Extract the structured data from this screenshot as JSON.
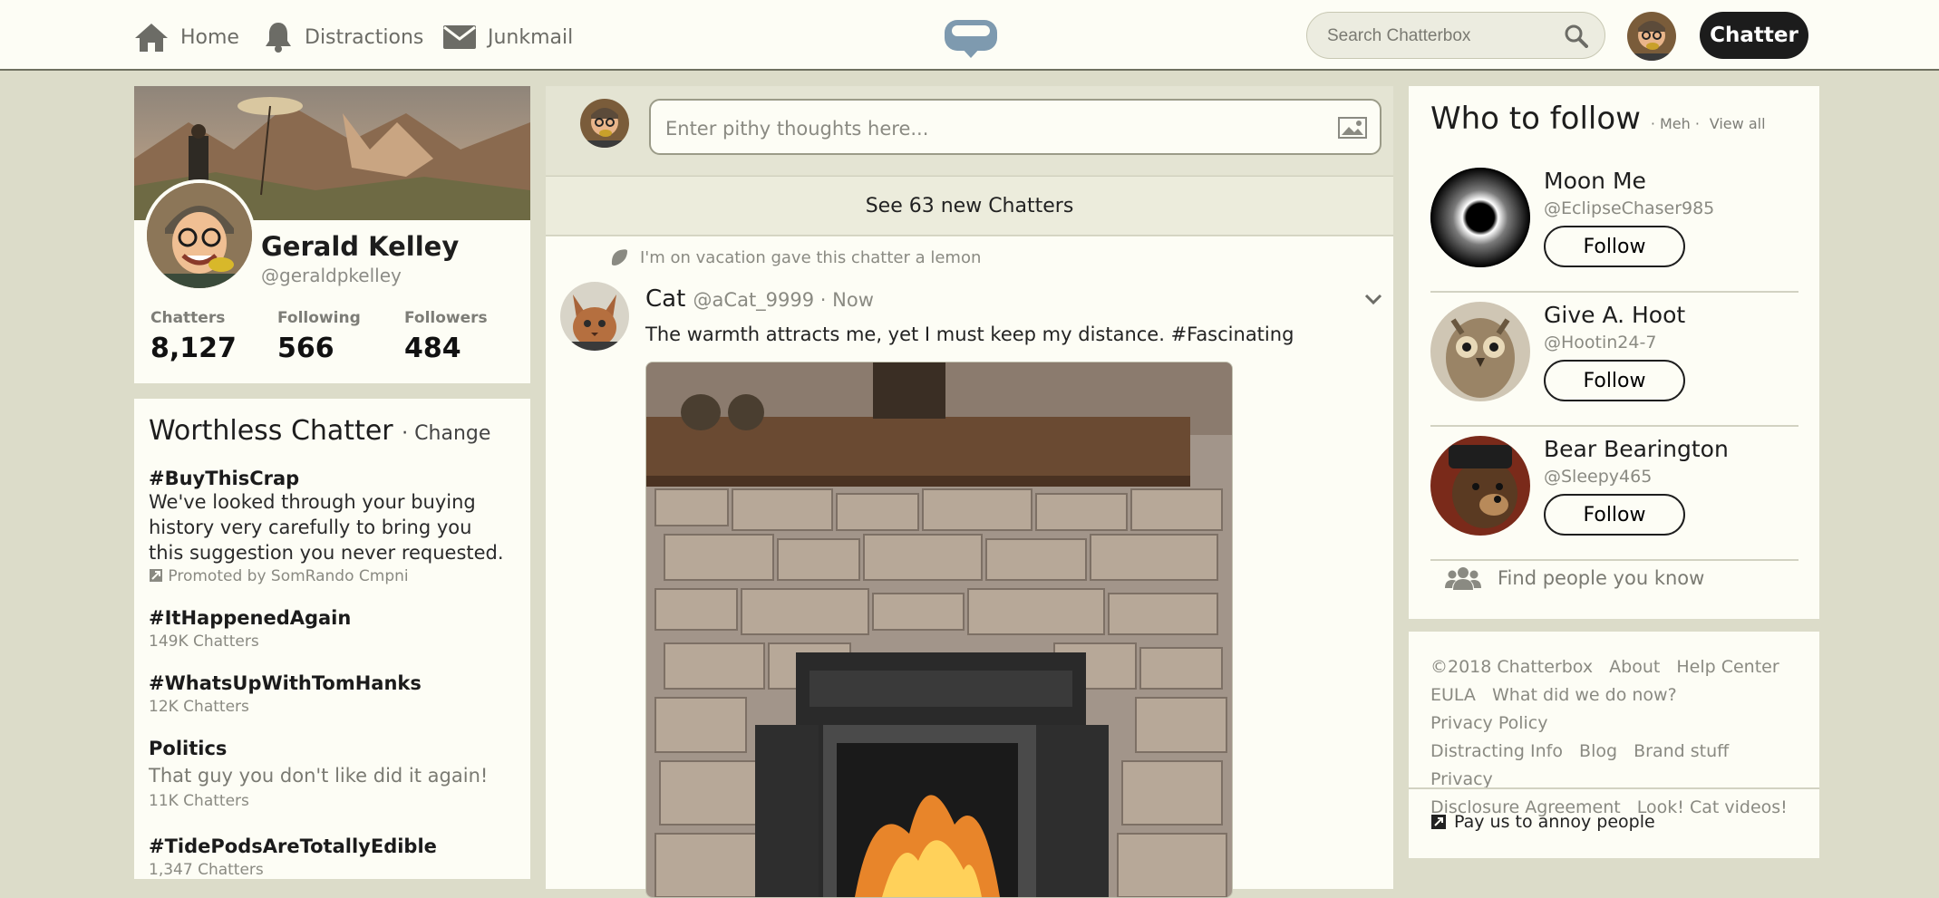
{
  "nav": {
    "home": "Home",
    "distractions": "Distractions",
    "junkmail": "Junkmail",
    "search_placeholder": "Search Chatterbox",
    "chatter_button": "Chatter"
  },
  "profile": {
    "name": "Gerald Kelley",
    "handle": "@geraldpkelley",
    "stats": [
      {
        "label": "Chatters",
        "value": "8,127"
      },
      {
        "label": "Following",
        "value": "566"
      },
      {
        "label": "Followers",
        "value": "484"
      }
    ]
  },
  "trends": {
    "title": "Worthless Chatter",
    "change": "· Change",
    "items": [
      {
        "tag": "#BuyThisCrap",
        "desc": "We've looked through your buying history very carefully to bring you this suggestion you never requested.",
        "promo": "Promoted by SomRando Cmpni"
      },
      {
        "tag": "#ItHappenedAgain",
        "count": "149K Chatters"
      },
      {
        "tag": "#WhatsUpWithTomHanks",
        "count": "12K Chatters"
      },
      {
        "tag": "Politics",
        "desc": "That guy you don't like did it again!",
        "count": "11K Chatters"
      },
      {
        "tag": "#TidePodsAreTotallyEdible",
        "count": "1,347 Chatters"
      }
    ]
  },
  "compose": {
    "placeholder": "Enter pithy thoughts here..."
  },
  "feed": {
    "new_chatters": "See 63 new Chatters",
    "post": {
      "reason": "I'm on vacation gave this chatter a lemon",
      "author": "Cat",
      "meta": "@aCat_9999 · Now",
      "text": "The warmth attracts me, yet I must keep my distance. #Fascinating"
    }
  },
  "who_to_follow": {
    "title": "Who to follow",
    "meh": "· Meh ·",
    "view_all": "View all",
    "suggestions": [
      {
        "name": "Moon Me",
        "handle": "@EclipseChaser985",
        "button": "Follow"
      },
      {
        "name": "Give A. Hoot",
        "handle": "@Hootin24-7",
        "button": "Follow"
      },
      {
        "name": "Bear Bearington",
        "handle": "@Sleepy465",
        "button": "Follow"
      }
    ],
    "find_people": "Find people you know"
  },
  "footer": {
    "links": [
      "©2018 Chatterbox",
      "About",
      "Help Center",
      "EULA",
      "What did we do now?",
      "Privacy Policy",
      "Distracting Info",
      "Blog",
      "Brand stuff",
      "Privacy",
      "Disclosure Agreement",
      "Look! Cat videos!"
    ],
    "promo": "Pay us to annoy people"
  }
}
